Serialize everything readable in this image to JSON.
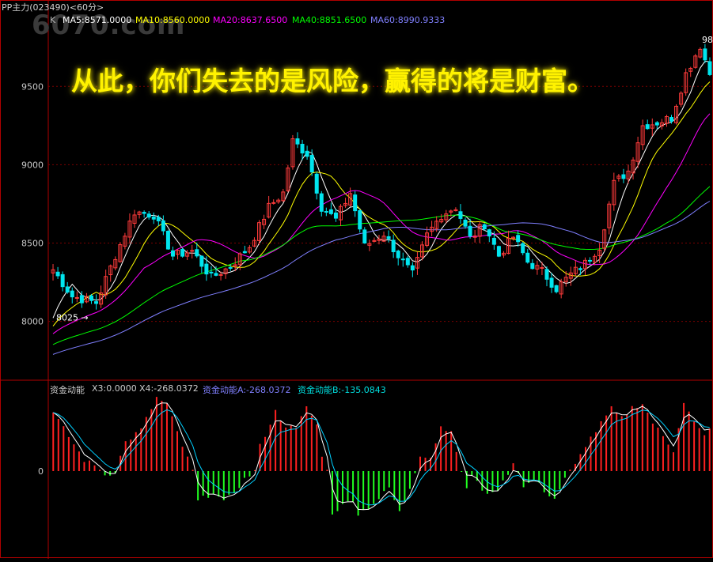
{
  "title": "PP主力(023490)<60分>",
  "watermark": "6070.com",
  "overlay_text": "从此，你们失去的是风险，赢得的将是财富。",
  "colors": {
    "background": "#000000",
    "up": "#ff3b3b",
    "down": "#00e5ee",
    "ma5": "#ffffff",
    "ma10": "#ffff00",
    "ma20": "#ff00ff",
    "ma40": "#00ff00",
    "ma60": "#7f7fff",
    "grid": "#7a0000",
    "frame": "#b00000",
    "axis_text": "#c8c8c8",
    "hist_pos": "#ff2020",
    "hist_neg": "#20ff20",
    "line_a": "#ffffff",
    "line_b": "#00d0ff"
  },
  "legend": {
    "prefix": "K",
    "ma5": "MA5:8571.0000",
    "ma10": "MA10:8560.0000",
    "ma20": "MA20:8637.6500",
    "ma40": "MA40:8851.6500",
    "ma60": "MA60:8990.9333"
  },
  "sub_legend": {
    "name": "资金动能",
    "x3": "X3:0.0000",
    "x4": "X4:-268.0372",
    "a": "资金动能A:-268.0372",
    "b": "资金动能B:-135.0843"
  },
  "chart_data": [
    {
      "type": "candlestick",
      "title": "",
      "y_ticks": [
        8000,
        8500,
        9000,
        9500
      ],
      "ylim": [
        7630,
        9900
      ],
      "grid": true,
      "annotations": [
        {
          "text": "8025 →",
          "value": 8025
        },
        {
          "text": "98",
          "value": 9800
        }
      ],
      "anchors": [
        [
          0,
          8330
        ],
        [
          4,
          8160
        ],
        [
          9,
          8120
        ],
        [
          13,
          8420
        ],
        [
          17,
          8700
        ],
        [
          21,
          8680
        ],
        [
          25,
          8420
        ],
        [
          29,
          8450
        ],
        [
          33,
          8280
        ],
        [
          37,
          8350
        ],
        [
          41,
          8480
        ],
        [
          45,
          8730
        ],
        [
          48,
          8820
        ],
        [
          50,
          9150
        ],
        [
          53,
          9070
        ],
        [
          56,
          8730
        ],
        [
          59,
          8650
        ],
        [
          62,
          8820
        ],
        [
          65,
          8480
        ],
        [
          69,
          8560
        ],
        [
          72,
          8420
        ],
        [
          75,
          8300
        ],
        [
          78,
          8550
        ],
        [
          81,
          8680
        ],
        [
          84,
          8730
        ],
        [
          87,
          8530
        ],
        [
          90,
          8620
        ],
        [
          93,
          8420
        ],
        [
          96,
          8540
        ],
        [
          99,
          8380
        ],
        [
          102,
          8320
        ],
        [
          105,
          8210
        ],
        [
          108,
          8300
        ],
        [
          111,
          8370
        ],
        [
          114,
          8480
        ],
        [
          117,
          8880
        ],
        [
          120,
          8960
        ],
        [
          123,
          9250
        ],
        [
          126,
          9270
        ],
        [
          129,
          9300
        ],
        [
          132,
          9580
        ],
        [
          135,
          9760
        ],
        [
          137,
          9580
        ]
      ],
      "series": [
        "MA5",
        "MA10",
        "MA20",
        "MA40",
        "MA60"
      ]
    },
    {
      "type": "histogram",
      "name": "资金动能",
      "zero_label": "0",
      "anchors": [
        [
          0,
          420
        ],
        [
          3,
          250
        ],
        [
          6,
          80
        ],
        [
          9,
          20
        ],
        [
          10,
          -30
        ],
        [
          12,
          0
        ],
        [
          14,
          210
        ],
        [
          17,
          300
        ],
        [
          20,
          530
        ],
        [
          22,
          480
        ],
        [
          25,
          180
        ],
        [
          27,
          0
        ],
        [
          28,
          -220
        ],
        [
          31,
          -150
        ],
        [
          33,
          -230
        ],
        [
          35,
          -150
        ],
        [
          37,
          -60
        ],
        [
          39,
          0
        ],
        [
          40,
          180
        ],
        [
          43,
          430
        ],
        [
          45,
          330
        ],
        [
          47,
          300
        ],
        [
          49,
          470
        ],
        [
          51,
          330
        ],
        [
          52,
          120
        ],
        [
          53,
          0
        ],
        [
          54,
          -300
        ],
        [
          56,
          -250
        ],
        [
          58,
          -200
        ],
        [
          59,
          -310
        ],
        [
          61,
          -260
        ],
        [
          63,
          -200
        ],
        [
          65,
          -120
        ],
        [
          67,
          -300
        ],
        [
          69,
          -120
        ],
        [
          70,
          0
        ],
        [
          71,
          120
        ],
        [
          73,
          100
        ],
        [
          75,
          320
        ],
        [
          77,
          300
        ],
        [
          78,
          120
        ],
        [
          79,
          0
        ],
        [
          80,
          -120
        ],
        [
          81,
          -40
        ],
        [
          83,
          -130
        ],
        [
          85,
          -170
        ],
        [
          87,
          -80
        ],
        [
          89,
          60
        ],
        [
          90,
          0
        ],
        [
          91,
          -120
        ],
        [
          93,
          -60
        ],
        [
          95,
          -140
        ],
        [
          97,
          -200
        ],
        [
          99,
          -60
        ],
        [
          100,
          0
        ],
        [
          101,
          40
        ],
        [
          103,
          190
        ],
        [
          105,
          290
        ],
        [
          108,
          450
        ],
        [
          110,
          380
        ],
        [
          112,
          460
        ],
        [
          114,
          490
        ],
        [
          116,
          350
        ],
        [
          118,
          250
        ],
        [
          120,
          150
        ],
        [
          122,
          500
        ],
        [
          124,
          350
        ],
        [
          126,
          250
        ],
        [
          127,
          300
        ]
      ]
    }
  ]
}
